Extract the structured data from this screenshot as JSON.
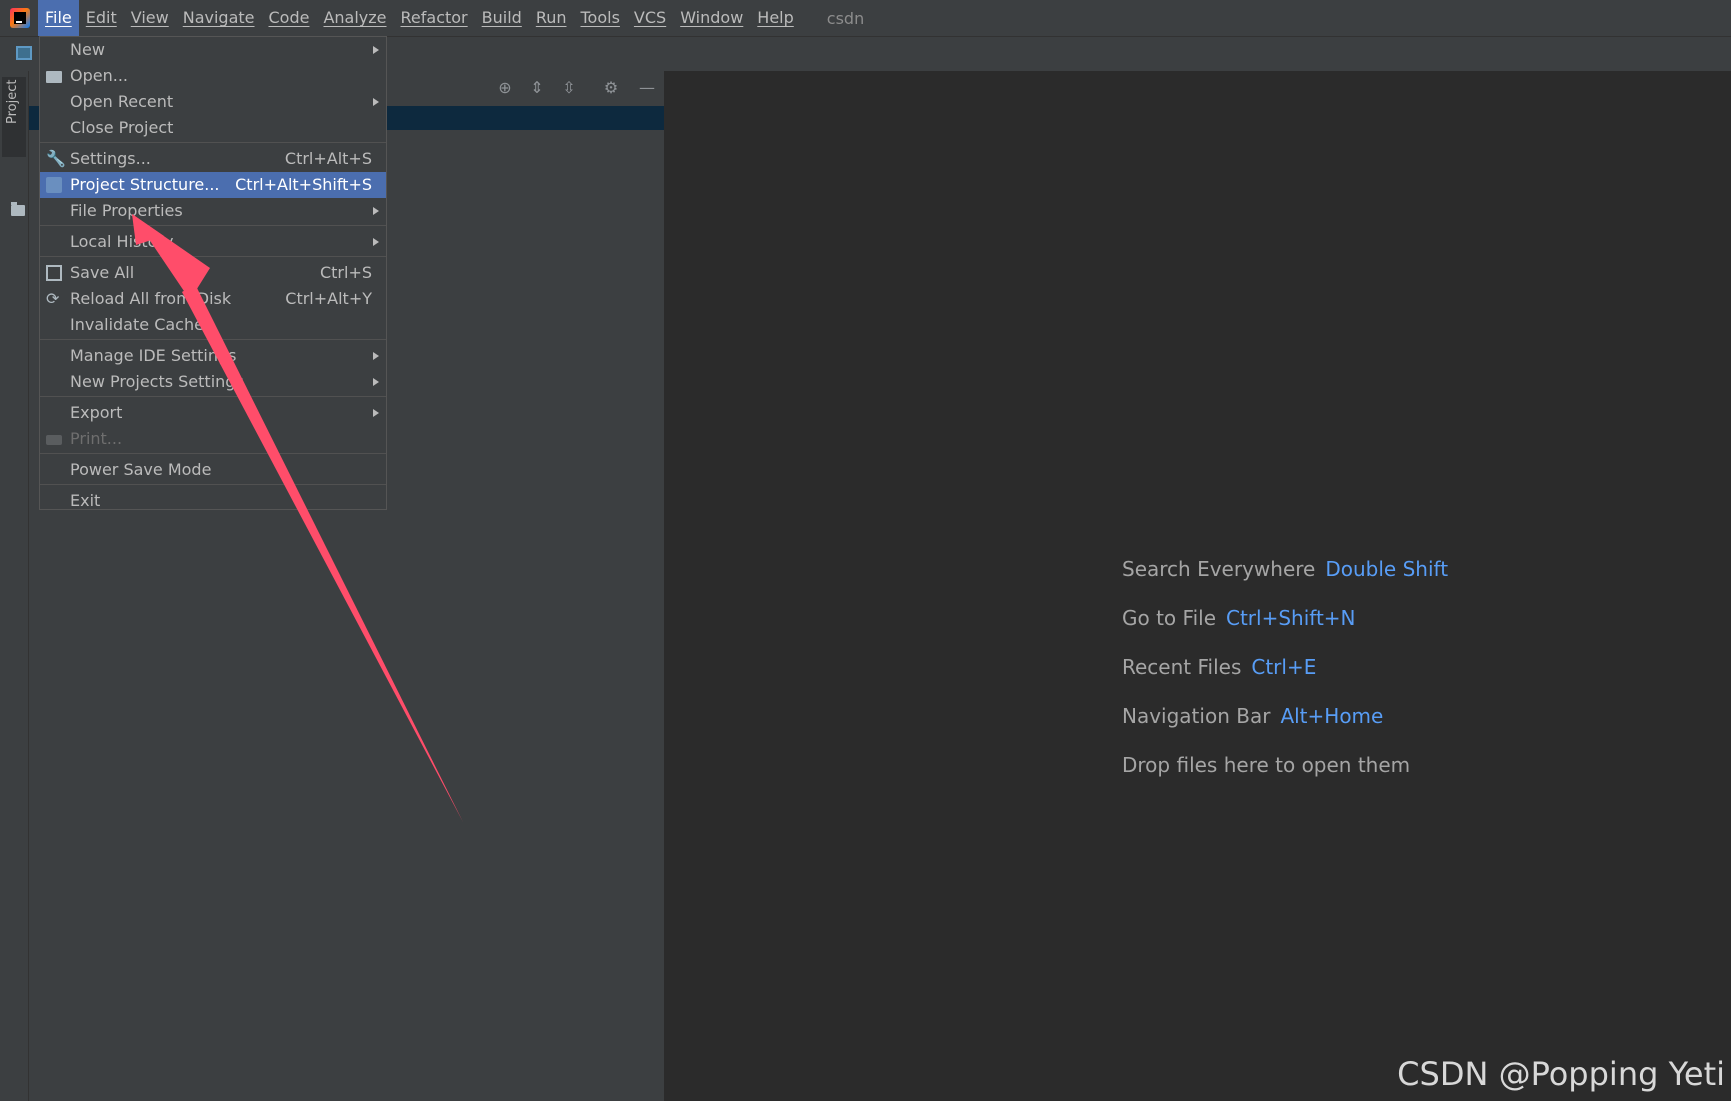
{
  "menubar": {
    "items": [
      "File",
      "Edit",
      "View",
      "Navigate",
      "Code",
      "Analyze",
      "Refactor",
      "Build",
      "Run",
      "Tools",
      "VCS",
      "Window",
      "Help"
    ],
    "active": "File",
    "project_name": "csdn"
  },
  "left_stripe": {
    "project_tab_label": "Project"
  },
  "file_menu": {
    "new": "New",
    "open": "Open...",
    "open_recent": "Open Recent",
    "close_project": "Close Project",
    "settings": "Settings...",
    "settings_shortcut": "Ctrl+Alt+S",
    "project_structure": "Project Structure...",
    "project_structure_shortcut": "Ctrl+Alt+Shift+S",
    "file_properties": "File Properties",
    "local_history": "Local History",
    "save_all": "Save All",
    "save_all_shortcut": "Ctrl+S",
    "reload_all": "Reload All from Disk",
    "reload_all_shortcut": "Ctrl+Alt+Y",
    "invalidate_caches": "Invalidate Caches",
    "manage_ide_settings": "Manage IDE Settings",
    "new_projects_settings": "New Projects Settings",
    "export": "Export",
    "print": "Print...",
    "power_save_mode": "Power Save Mode",
    "exit": "Exit"
  },
  "editor_hints": {
    "search_everywhere": {
      "label": "Search Everywhere",
      "key": "Double Shift"
    },
    "go_to_file": {
      "label": "Go to File",
      "key": "Ctrl+Shift+N"
    },
    "recent_files": {
      "label": "Recent Files",
      "key": "Ctrl+E"
    },
    "navigation_bar": {
      "label": "Navigation Bar",
      "key": "Alt+Home"
    },
    "drop_files": "Drop files here to open them"
  },
  "watermark": "CSDN @Popping Yeti",
  "colors": {
    "menu_bg": "#3c3f41",
    "editor_bg": "#2b2b2b",
    "selection": "#4b6eaf",
    "shortcut_key": "#589df6",
    "annotation_arrow": "#ff4d6a"
  }
}
